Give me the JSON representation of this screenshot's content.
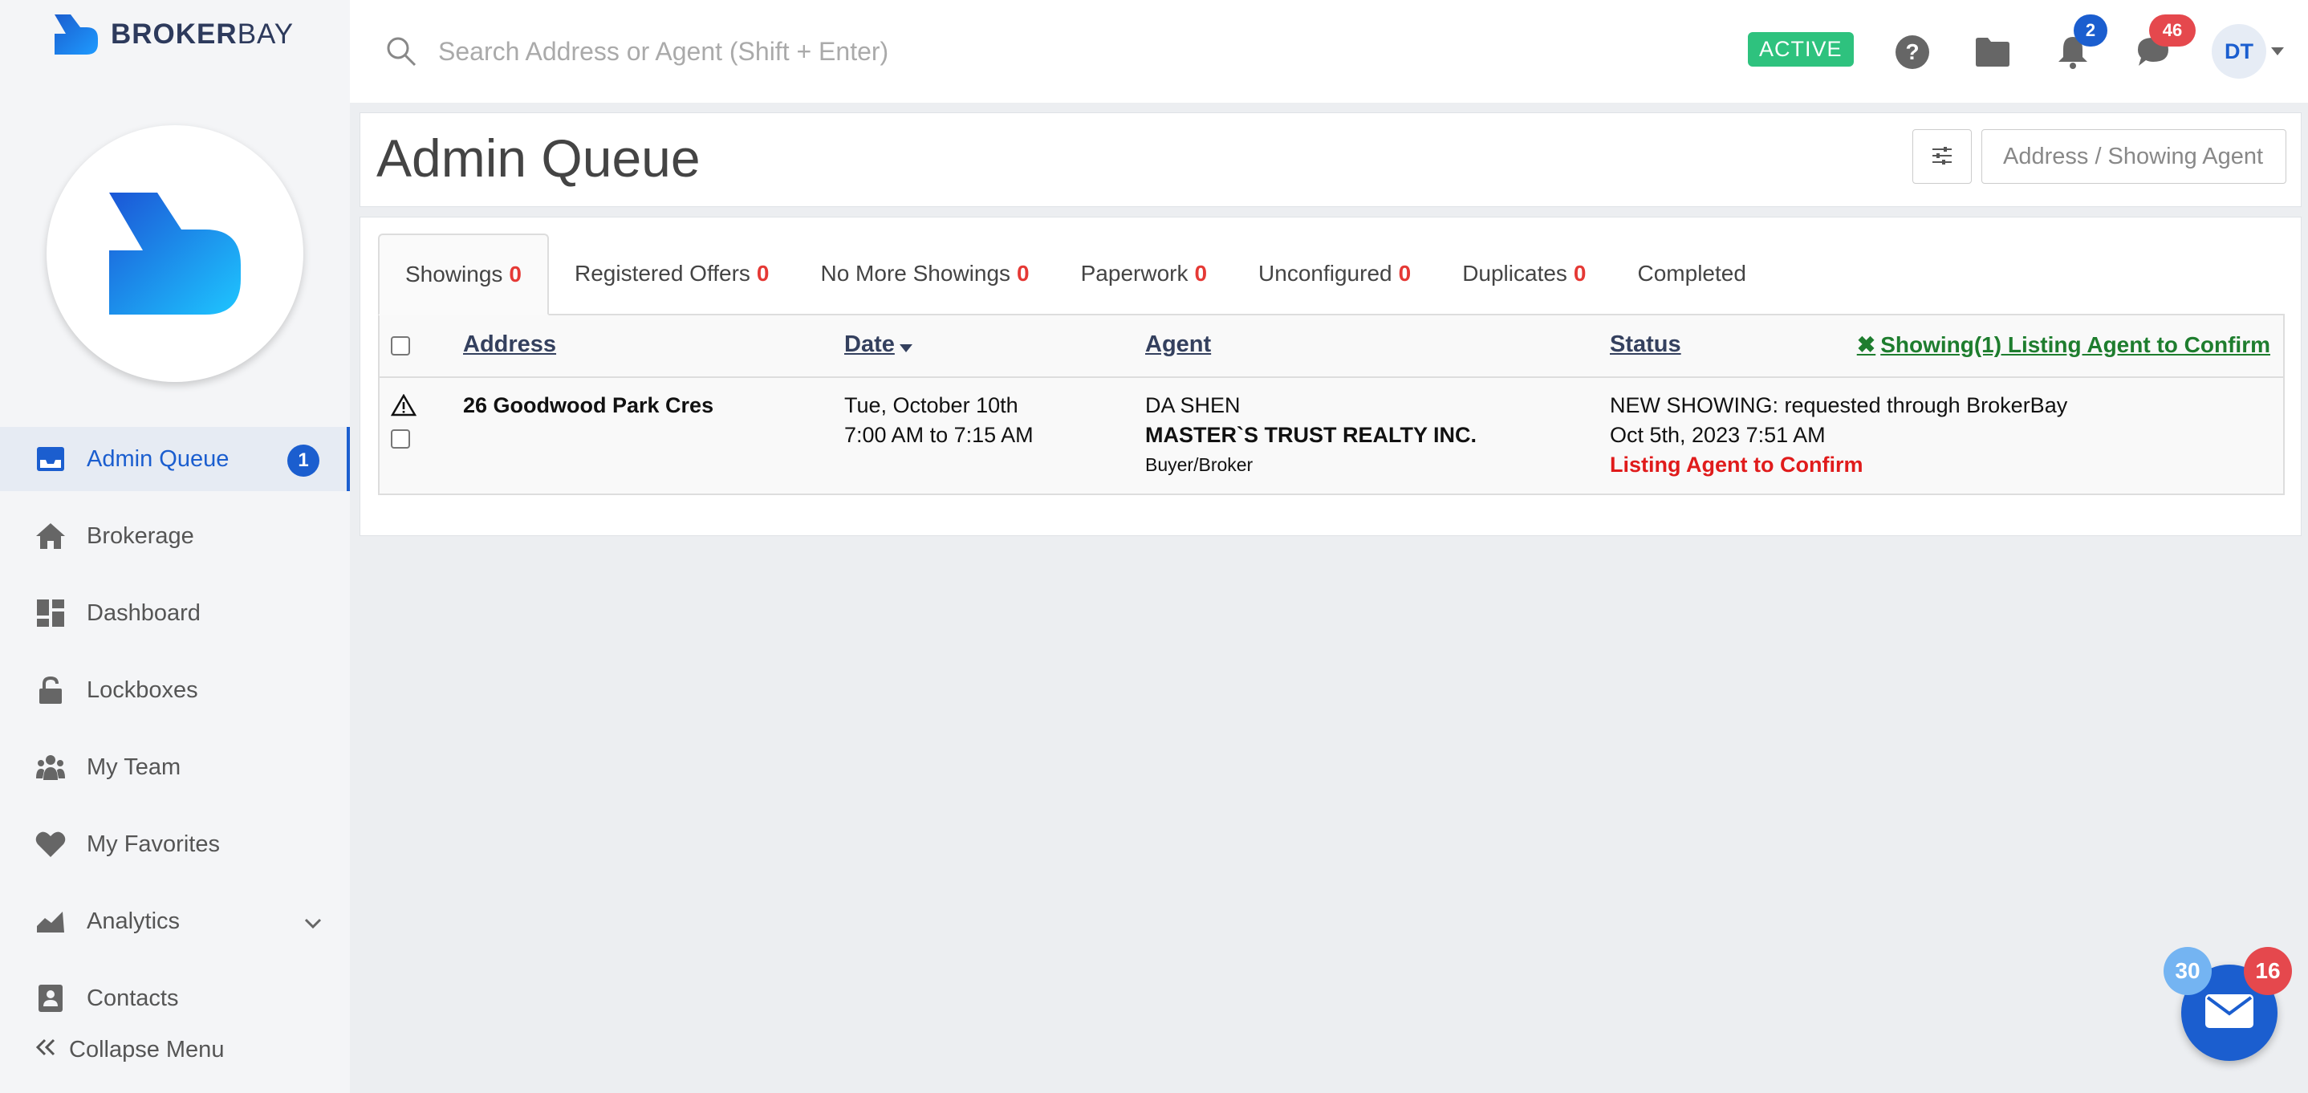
{
  "brand": {
    "name_bold": "BROKER",
    "name_light": "BAY"
  },
  "search": {
    "placeholder": "Search Address or Agent (Shift + Enter)"
  },
  "topbar": {
    "status": "ACTIVE",
    "notifications_count": "2",
    "messages_count": "46",
    "user_initials": "DT"
  },
  "sidebar": {
    "items": [
      {
        "label": "Admin Queue",
        "icon": "inbox-icon",
        "badge": "1",
        "active": true
      },
      {
        "label": "Brokerage",
        "icon": "home-icon"
      },
      {
        "label": "Dashboard",
        "icon": "dashboard-icon"
      },
      {
        "label": "Lockboxes",
        "icon": "lock-icon"
      },
      {
        "label": "My Team",
        "icon": "team-icon"
      },
      {
        "label": "My Favorites",
        "icon": "heart-icon"
      },
      {
        "label": "Analytics",
        "icon": "chart-icon"
      },
      {
        "label": "Contacts",
        "icon": "contacts-icon"
      }
    ],
    "collapse_label": "Collapse Menu"
  },
  "header": {
    "title": "Admin Queue",
    "filter_placeholder": "Address / Showing Agent"
  },
  "tabs": [
    {
      "label": "Showings",
      "count": "0"
    },
    {
      "label": "Registered Offers",
      "count": "0"
    },
    {
      "label": "No More Showings",
      "count": "0"
    },
    {
      "label": "Paperwork",
      "count": "0"
    },
    {
      "label": "Unconfigured",
      "count": "0"
    },
    {
      "label": "Duplicates",
      "count": "0"
    },
    {
      "label": "Completed",
      "count": ""
    }
  ],
  "table": {
    "columns": {
      "address": "Address",
      "date": "Date",
      "agent": "Agent",
      "status": "Status"
    },
    "action_link": "Showing(1) Listing Agent to Confirm",
    "rows": [
      {
        "address": "26 Goodwood Park Cres",
        "date_line1": "Tue, October 10th",
        "date_line2": "7:00 AM to 7:15 AM",
        "agent_name": "DA SHEN",
        "agent_brokerage": "MASTER`S TRUST REALTY INC.",
        "agent_role": "Buyer/Broker",
        "status_line1": "NEW SHOWING: requested through BrokerBay",
        "status_line2": "Oct 5th, 2023 7:51 AM",
        "status_line3": "Listing Agent to Confirm"
      }
    ]
  },
  "chat": {
    "left_badge": "30",
    "right_badge": "16"
  },
  "colors": {
    "accent": "#1b5ecf",
    "status_green": "#2ec27e",
    "alert_red": "#e01b1b",
    "link_green": "#1e7d2e"
  }
}
